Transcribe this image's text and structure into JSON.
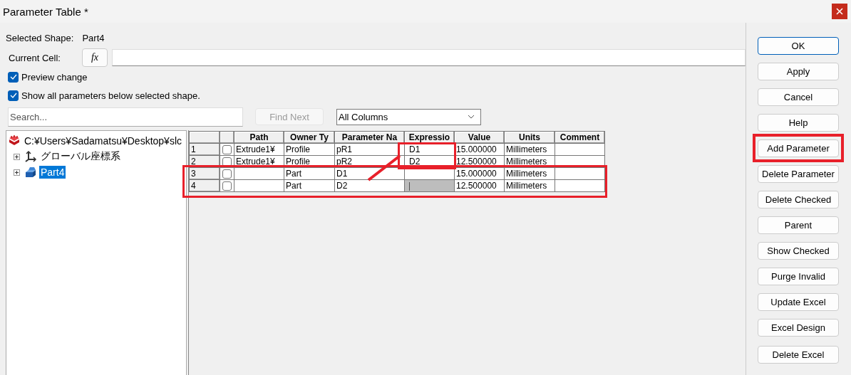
{
  "window": {
    "title": "Parameter Table *"
  },
  "selected_shape": {
    "label": "Selected Shape:",
    "value": "Part4"
  },
  "current_cell": {
    "label": "Current Cell:",
    "fx": "fx"
  },
  "options": [
    {
      "label": "Preview change",
      "checked": true
    },
    {
      "label": "Show all parameters below selected shape.",
      "checked": true
    }
  ],
  "search": {
    "placeholder": "Search...",
    "find_next": {
      "label": "Find Next",
      "disabled": true
    },
    "scope": "All Columns"
  },
  "tree": [
    {
      "label": "C:¥Users¥Sadamatsu¥Desktop¥slc",
      "kind": "file",
      "selected": false,
      "children": [
        {
          "label": "グローバル座標系",
          "kind": "axes",
          "expanded": false,
          "selected": false
        },
        {
          "label": "Part4",
          "kind": "part",
          "expanded": false,
          "selected": true
        }
      ]
    }
  ],
  "table": {
    "columns": [
      "",
      "",
      "Path",
      "Owner Ty",
      "Parameter Na",
      "Expressio",
      "Value",
      "Units",
      "Comment"
    ],
    "rows": [
      {
        "index": "1",
        "checked": false,
        "path": "Extrude1¥",
        "owner": "Profile",
        "name": "pR1",
        "expression": "D1",
        "editing": false,
        "value": "15.000000",
        "units": "Millimeters",
        "comment": ""
      },
      {
        "index": "2",
        "checked": false,
        "path": "Extrude1¥",
        "owner": "Profile",
        "name": "pR2",
        "expression": "D2",
        "editing": false,
        "value": "12.500000",
        "units": "Millimeters",
        "comment": ""
      },
      {
        "index": "3",
        "checked": false,
        "path": "",
        "owner": "Part",
        "name": "D1",
        "expression": "",
        "editing": false,
        "value": "15.000000",
        "units": "Millimeters",
        "comment": ""
      },
      {
        "index": "4",
        "checked": false,
        "path": "",
        "owner": "Part",
        "name": "D2",
        "expression": "",
        "editing": true,
        "value": "12.500000",
        "units": "Millimeters",
        "comment": ""
      }
    ]
  },
  "buttons": [
    {
      "label": "OK",
      "default": true
    },
    {
      "label": "Apply",
      "default": false
    },
    {
      "label": "Cancel",
      "default": false
    },
    {
      "label": "Help",
      "default": false
    },
    {
      "label": "Add Parameter",
      "default": false
    },
    {
      "label": "Delete Parameter",
      "default": false
    },
    {
      "label": "Delete Checked",
      "default": false
    },
    {
      "label": "Parent",
      "default": false
    },
    {
      "label": "Show Checked",
      "default": false
    },
    {
      "label": "Purge Invalid",
      "default": false
    },
    {
      "label": "Update Excel",
      "default": false
    },
    {
      "label": "Excel Design",
      "default": false
    },
    {
      "label": "Delete Excel",
      "default": false
    }
  ]
}
